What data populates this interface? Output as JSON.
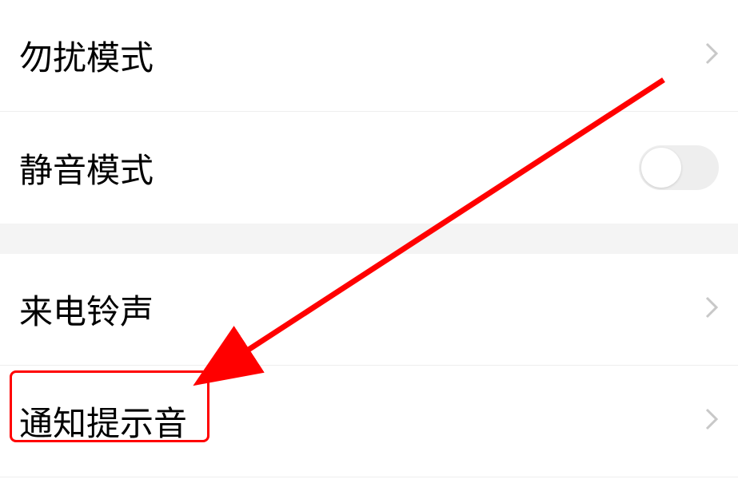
{
  "settings": {
    "items": [
      {
        "label": "勿扰模式",
        "type": "chevron"
      },
      {
        "label": "静音模式",
        "type": "toggle",
        "value": false
      },
      {
        "label": "来电铃声",
        "type": "chevron"
      },
      {
        "label": "通知提示音",
        "type": "chevron"
      }
    ]
  },
  "annotation": {
    "highlight_target": "通知提示音",
    "arrow_color": "#ff0000"
  }
}
